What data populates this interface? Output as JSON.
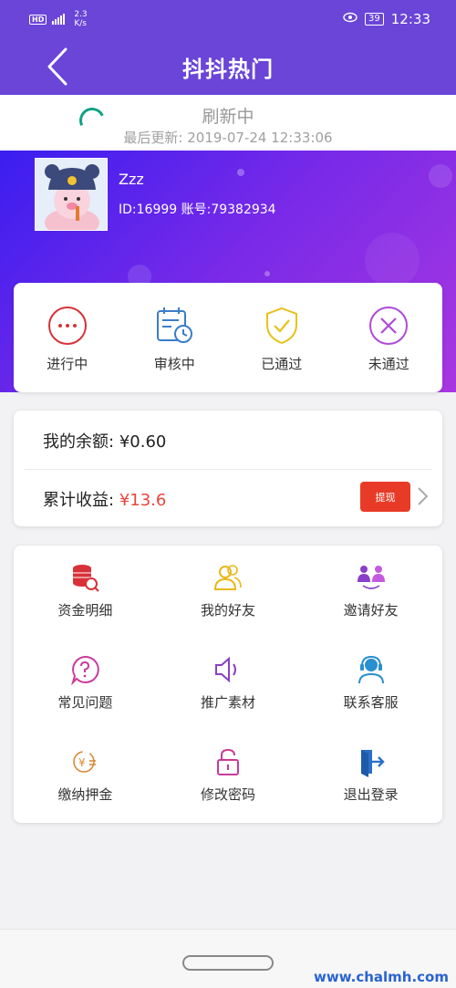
{
  "status_bar": {
    "network_badge": "HD",
    "speed_value": "2.3",
    "speed_unit": "K/s",
    "battery": "39",
    "time": "12:33"
  },
  "header": {
    "title": "抖抖热门"
  },
  "refresh": {
    "title": "刷新中",
    "last_update": "最后更新: 2019-07-24 12:33:06"
  },
  "profile": {
    "username": "Zzz",
    "id_line": "ID:16999 账号:79382934"
  },
  "status_tabs": [
    {
      "label": "进行中",
      "icon": "dots-circle-icon",
      "color": "#d8313a"
    },
    {
      "label": "审核中",
      "icon": "calendar-clock-icon",
      "color": "#3a7dc8"
    },
    {
      "label": "已通过",
      "icon": "shield-check-icon",
      "color": "#e8c21a"
    },
    {
      "label": "未通过",
      "icon": "x-circle-icon",
      "color": "#b04ad6"
    }
  ],
  "balance": {
    "balance_label": "我的余额:",
    "balance_value": "¥0.60",
    "earnings_label": "累计收益:",
    "earnings_value": "¥13.6",
    "withdraw_label": "提现"
  },
  "menu": [
    {
      "label": "资金明细",
      "icon": "coins-search-icon"
    },
    {
      "label": "我的好友",
      "icon": "friends-icon"
    },
    {
      "label": "邀请好友",
      "icon": "invite-icon"
    },
    {
      "label": "常见问题",
      "icon": "question-icon"
    },
    {
      "label": "推广素材",
      "icon": "speaker-icon"
    },
    {
      "label": "联系客服",
      "icon": "headset-icon"
    },
    {
      "label": "缴纳押金",
      "icon": "deposit-icon"
    },
    {
      "label": "修改密码",
      "icon": "lock-icon"
    },
    {
      "label": "退出登录",
      "icon": "logout-icon"
    }
  ],
  "watermark": "www.chalmh.com",
  "colors": {
    "header_bg": "#6a45d8",
    "accent_red": "#e8453c",
    "withdraw_bg": "#e83b27"
  }
}
